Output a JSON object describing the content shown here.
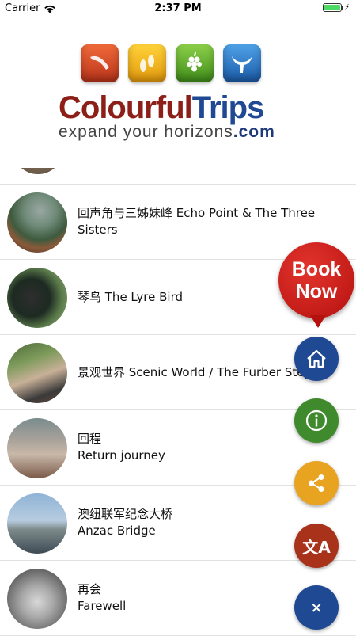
{
  "status_bar": {
    "carrier": "Carrier",
    "time": "2:37 PM",
    "battery_level": 1.0,
    "charging": true
  },
  "header": {
    "brand_part1": "Colourful",
    "brand_part2": "Trips",
    "tagline": "expand your horizons",
    "tagline_suffix": ".com",
    "icons": [
      "boomerang-icon",
      "footprints-icon",
      "grapes-icon",
      "whale-tail-icon"
    ]
  },
  "list": {
    "items": [
      {
        "label_line1": "回声角与三姊妹峰 Echo Point & The Three Sisters",
        "label_line2": "",
        "thumb": "echo-point-photo"
      },
      {
        "label_line1": "琴鸟 The Lyre Bird",
        "label_line2": "",
        "thumb": "lyre-bird-photo"
      },
      {
        "label_line1": "景观世界 Scenic World / The Furber Steps",
        "label_line2": "",
        "thumb": "scenic-world-photo"
      },
      {
        "label_line1": "回程",
        "label_line2": "Return journey",
        "thumb": "return-journey-photo"
      },
      {
        "label_line1": "澳纽联军纪念大桥",
        "label_line2": "Anzac Bridge",
        "thumb": "anzac-bridge-photo"
      },
      {
        "label_line1": "再会",
        "label_line2": "Farewell",
        "thumb": "koala-photo"
      }
    ]
  },
  "fab": {
    "book_now_line1": "Book",
    "book_now_line2": "Now",
    "close_glyph": "×",
    "lang_glyph": "文A"
  },
  "colors": {
    "brand_red": "#8c1f17",
    "brand_blue": "#1f4a93",
    "book_red": "#d11f1a",
    "info_green": "#3f8a2c",
    "share_yellow": "#e8a320",
    "lang_rust": "#a8331a"
  }
}
